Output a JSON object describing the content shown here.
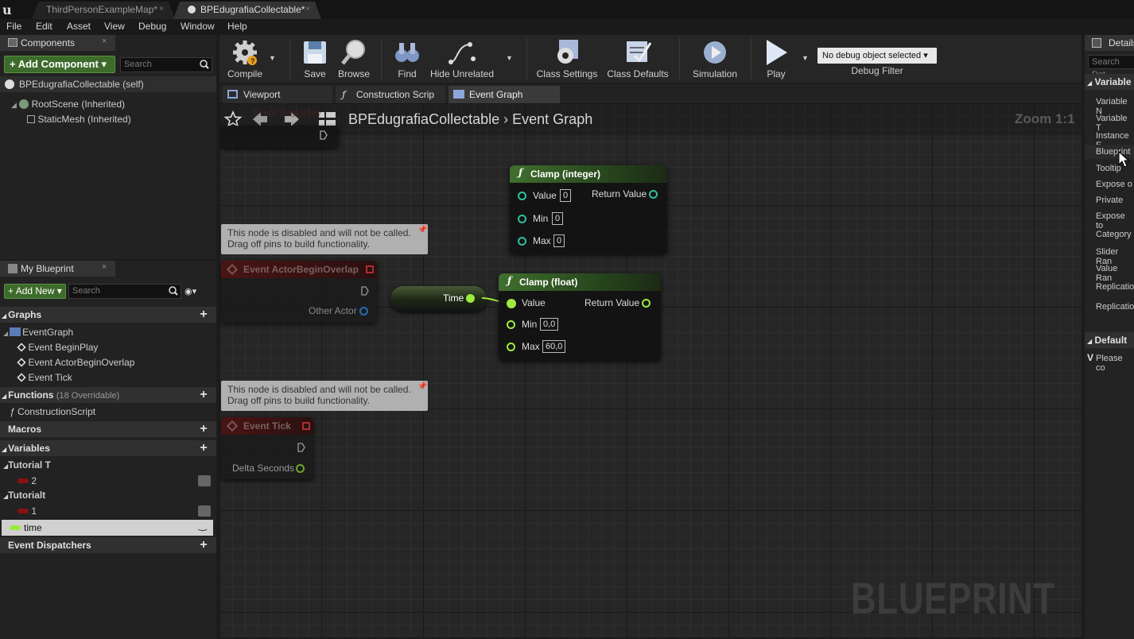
{
  "titlebar": {
    "tabs": [
      "ThirdPersonExampleMap*",
      "BPEdugrafiaCollectable*"
    ]
  },
  "menu": [
    "File",
    "Edit",
    "Asset",
    "View",
    "Debug",
    "Window",
    "Help"
  ],
  "components": {
    "title": "Components",
    "add_button": "+ Add Component",
    "search_placeholder": "Search",
    "self": "BPEdugrafiaCollectable (self)",
    "root": "RootScene (Inherited)",
    "mesh": "StaticMesh (Inherited)"
  },
  "toolbar": {
    "compile": "Compile",
    "save": "Save",
    "browse": "Browse",
    "find": "Find",
    "hide_unrelated": "Hide Unrelated",
    "class_settings": "Class Settings",
    "class_defaults": "Class Defaults",
    "simulation": "Simulation",
    "play": "Play",
    "debug_select": "No debug object selected",
    "debug_filter": "Debug Filter"
  },
  "editor_tabs": [
    "Viewport",
    "Construction Scrip",
    "Event Graph"
  ],
  "breadcrumb": {
    "blueprint": "BPEdugrafiaCollectable",
    "graph": "Event Graph",
    "zoom": "Zoom 1:1"
  },
  "myblueprint": {
    "title": "My Blueprint",
    "add_new": "Add New",
    "search_placeholder": "Search",
    "graphs": "Graphs",
    "eventgraph": "EventGraph",
    "events": [
      "Event BeginPlay",
      "Event ActorBeginOverlap",
      "Event Tick"
    ],
    "functions": "Functions",
    "functions_count": "(18 Overridable)",
    "construction": "ConstructionScript",
    "macros": "Macros",
    "variables": "Variables",
    "cat1": "Tutorial T",
    "var1": "2",
    "cat2": "Tutorialt",
    "var2": "1",
    "var3": "time",
    "dispatchers": "Event Dispatchers"
  },
  "nodes": {
    "comment_text1": "This node is disabled and will not be called.",
    "comment_text2": "Drag off pins to build functionality.",
    "overlap_title": "Event ActorBeginOverlap",
    "overlap_pin": "Other Actor",
    "tick_title": "Event Tick",
    "tick_pin": "Delta Seconds",
    "time_var": "Time",
    "clamp_int": {
      "title": "Clamp (integer)",
      "value_lbl": "Value",
      "value": "0",
      "min_lbl": "Min",
      "min": "0",
      "max_lbl": "Max",
      "max": "0",
      "ret": "Return Value"
    },
    "clamp_float": {
      "title": "Clamp (float)",
      "value_lbl": "Value",
      "min_lbl": "Min",
      "min": "0,0",
      "max_lbl": "Max",
      "max": "60,0",
      "ret": "Return Value"
    },
    "top_partial": "Event BeginPlay"
  },
  "watermark": "BLUEPRINT",
  "details": {
    "title": "Details",
    "search_placeholder": "Search Det",
    "section1": "Variable",
    "rows": [
      "Variable N",
      "Variable T",
      "Instance E",
      "Blueprint",
      "Tooltip",
      "Expose o",
      "Private",
      "Expose to",
      "Category",
      "Slider Ran",
      "Value Ran",
      "Replicatio",
      "Replicatio"
    ],
    "section2": "Default V",
    "please": "Please co"
  },
  "colors": {
    "float_pin": "#9dea3e",
    "exec": "#ffffff",
    "object_pin": "#2a8ee0",
    "func_header": "#3d6b2b",
    "event_header": "#7a1d1d",
    "int_var": "#6b0f0f"
  }
}
